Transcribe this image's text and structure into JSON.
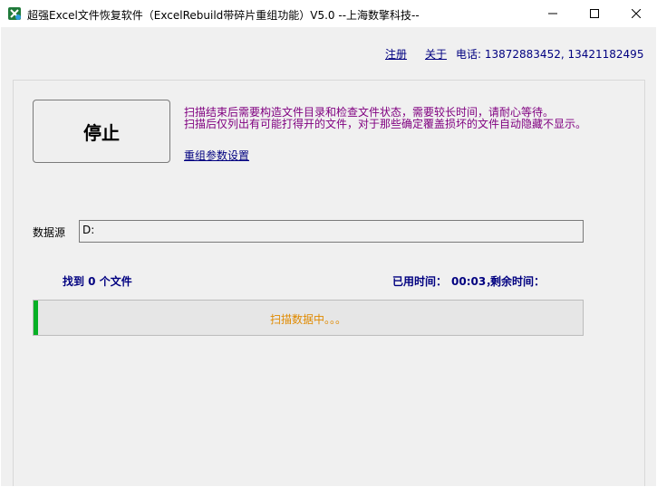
{
  "window": {
    "title": "超强Excel文件恢复软件（ExcelRebuild带碎片重组功能）V5.0  --上海数擎科技--",
    "icon": "spreadsheet-app-icon"
  },
  "header": {
    "register_label": "注册",
    "about_label": "关于",
    "phone_text": "电话: 13872883452, 13421182495"
  },
  "controls": {
    "stop_button_label": "停止",
    "info_line1": "扫描结束后需要构造文件目录和检查文件状态，需要较长时间，请耐心等待。",
    "info_line2": "扫描后仅列出有可能打得开的文件，对于那些确定覆盖损坏的文件自动隐藏不显示。",
    "settings_link": "重组参数设置"
  },
  "source": {
    "label": "数据源",
    "value": "D:"
  },
  "status": {
    "found_text": "找到 0 个文件",
    "elapsed_label": "已用时间：",
    "elapsed_value": "00:03，",
    "remaining_label": "剩余时间："
  },
  "progress": {
    "text": "扫描数据中。。。",
    "fraction": 0.008,
    "fill_color": "#06b025"
  },
  "colors": {
    "link": "#000080",
    "info_text": "#800080",
    "progress_text": "#e08a00"
  }
}
